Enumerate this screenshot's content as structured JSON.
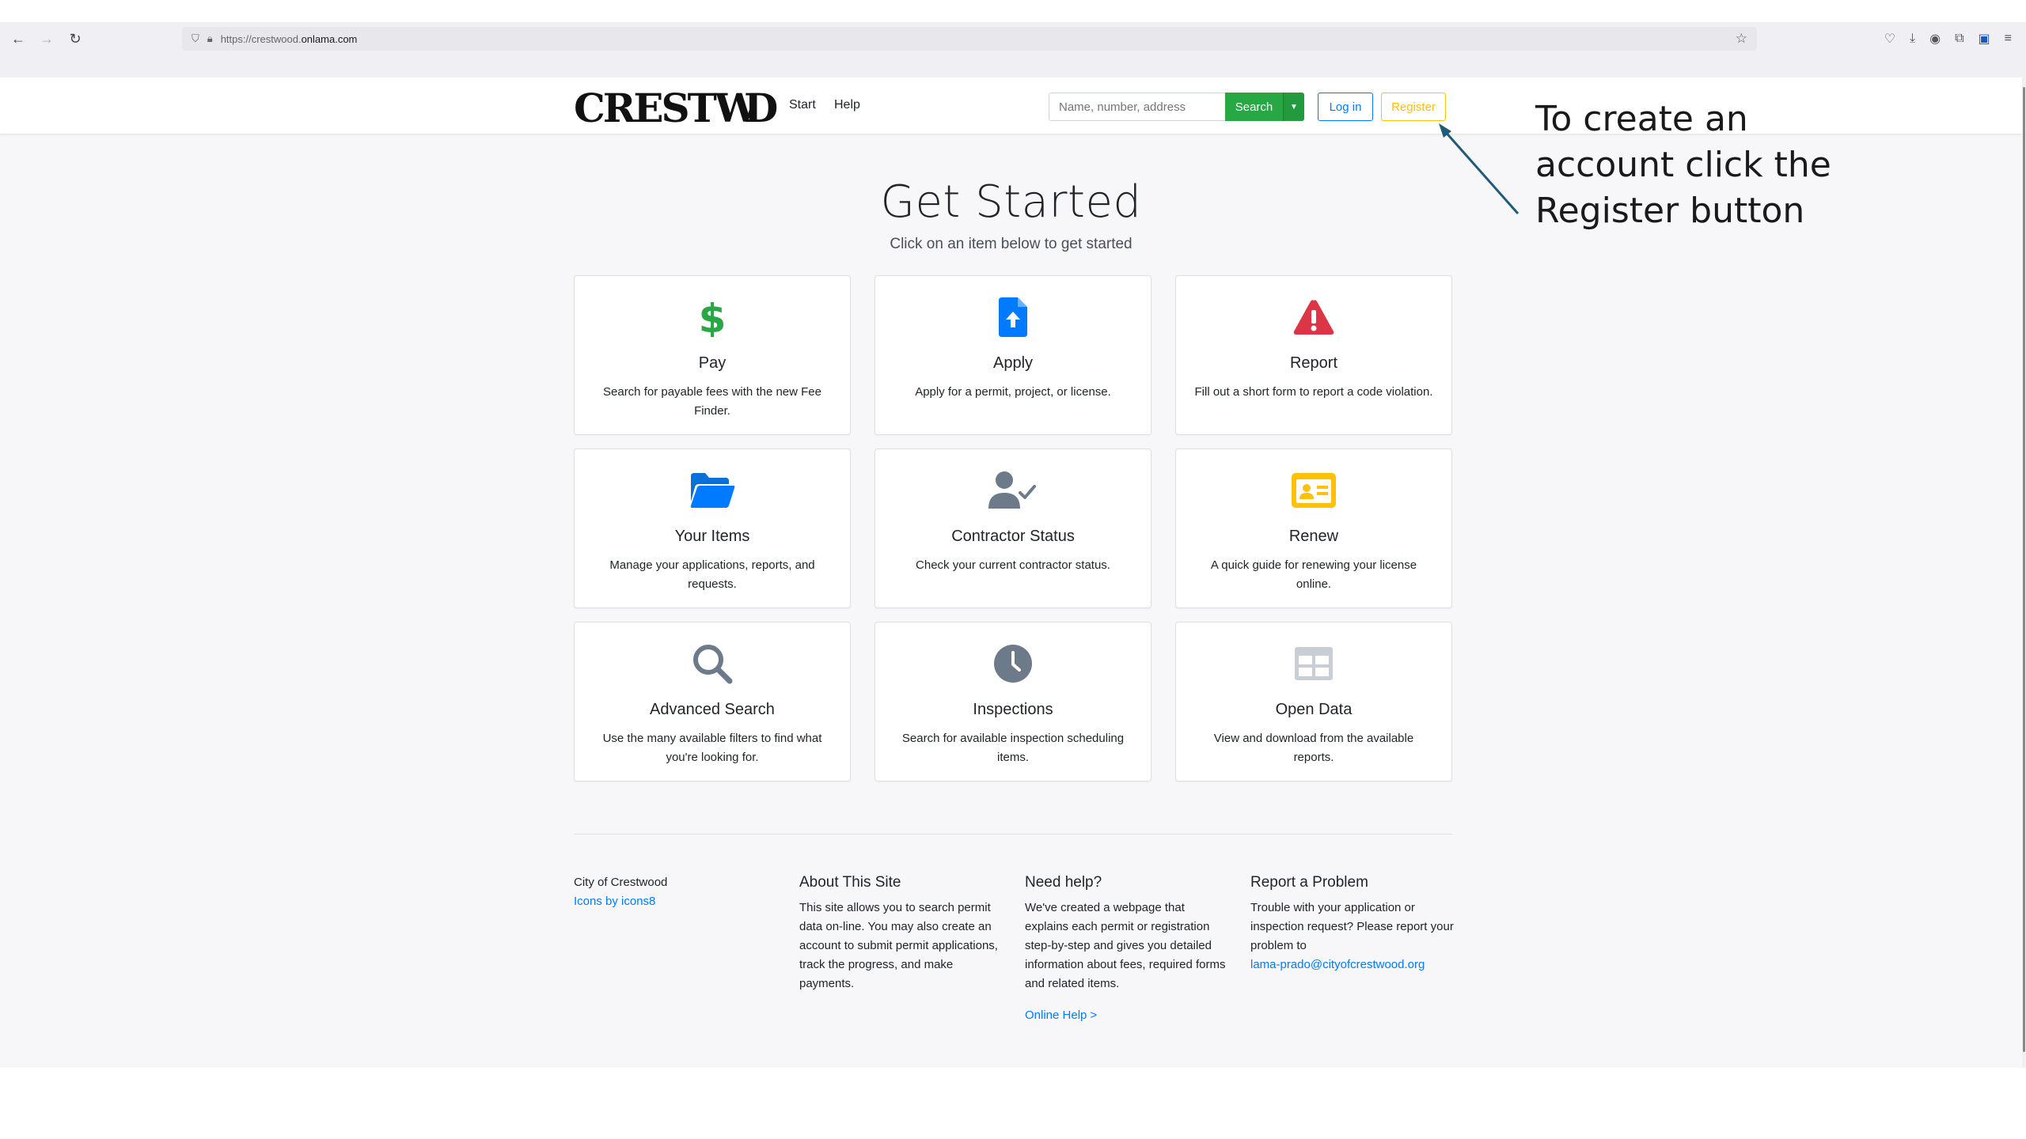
{
  "browser": {
    "url_prefix": "https://crestwood.",
    "url_host": "onlama.com"
  },
  "header": {
    "nav": [
      {
        "label": "Start"
      },
      {
        "label": "Help"
      }
    ],
    "search": {
      "placeholder": "Name, number, address",
      "button_label": "Search"
    },
    "login_label": "Log in",
    "register_label": "Register"
  },
  "main": {
    "title": "Get Started",
    "subtitle": "Click on an item below to get started",
    "cards": [
      {
        "title": "Pay",
        "desc": "Search for payable fees with the new Fee Finder.",
        "icon": "dollar-icon"
      },
      {
        "title": "Apply",
        "desc": "Apply for a permit, project, or license.",
        "icon": "file-upload-icon"
      },
      {
        "title": "Report",
        "desc": "Fill out a short form to report a code violation.",
        "icon": "warning-icon"
      },
      {
        "title": "Your Items",
        "desc": "Manage your applications, reports, and requests.",
        "icon": "folder-icon"
      },
      {
        "title": "Contractor Status",
        "desc": "Check your current contractor status.",
        "icon": "user-check-icon"
      },
      {
        "title": "Renew",
        "desc": "A quick guide for renewing your license online.",
        "icon": "id-card-icon"
      },
      {
        "title": "Advanced Search",
        "desc": "Use the many available filters to find what you're looking for.",
        "icon": "magnifier-icon"
      },
      {
        "title": "Inspections",
        "desc": "Search for available inspection scheduling items.",
        "icon": "clock-icon"
      },
      {
        "title": "Open Data",
        "desc": "View and download from the available reports.",
        "icon": "table-icon"
      }
    ]
  },
  "footer": {
    "city": "City of Crestwood",
    "icons_credit": "Icons by icons8",
    "about_title": "About This Site",
    "about_text": "This site allows you to search permit data on-line. You may also create an account to submit permit applications, track the progress, and make payments.",
    "help_title": "Need help?",
    "help_text": "We've created a webpage that explains each permit or registration step-by-step and gives you detailed information about fees, required forms and related items.",
    "help_link": "Online Help >",
    "problem_title": "Report a Problem",
    "problem_text": "Trouble with your application or inspection request? Please report your problem to",
    "problem_email": "lama-prado@cityofcrestwood.org"
  },
  "annotation": {
    "text": "To create an account click the Register button"
  },
  "colors": {
    "green": "#28a745",
    "blue": "#007bff",
    "red": "#dc3545",
    "yellow": "#ffc107",
    "gray": "#6c7a89"
  }
}
